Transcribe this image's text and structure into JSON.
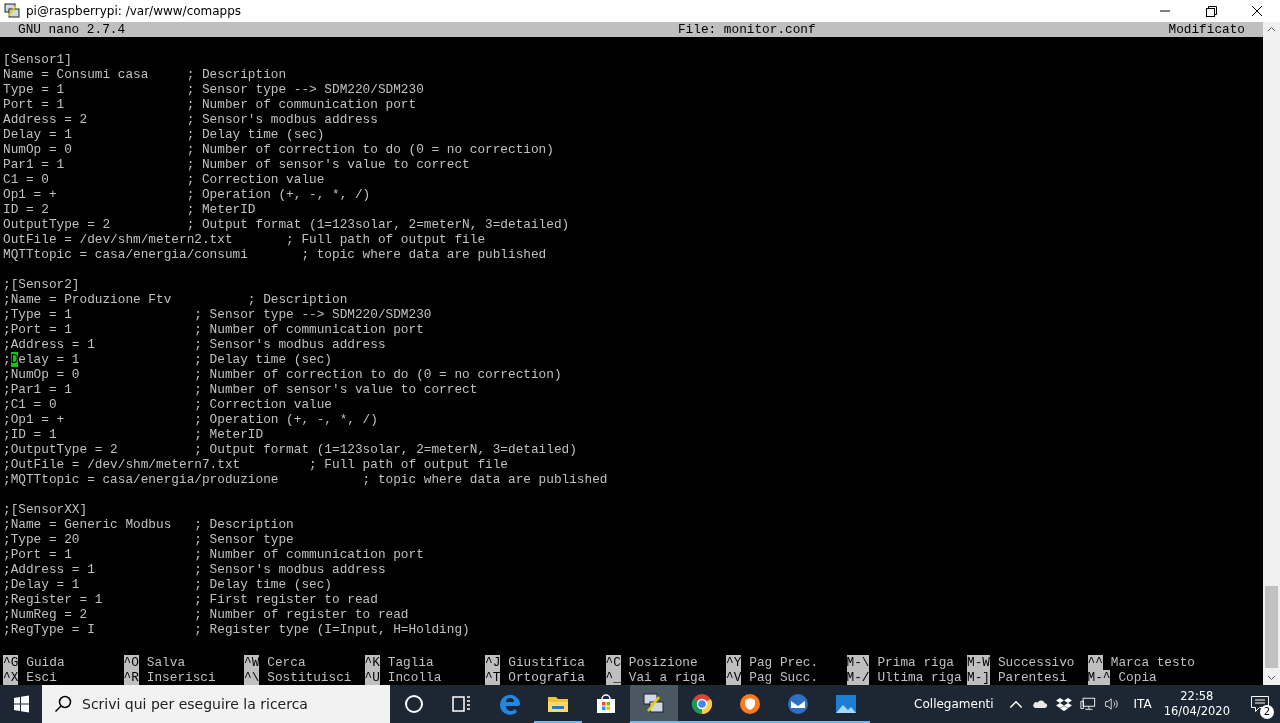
{
  "window": {
    "title": "pi@raspberrypi: /var/www/comapps"
  },
  "nano_header": {
    "version": "GNU nano 2.7.4",
    "file": "File: monitor.conf",
    "state": "Modificato"
  },
  "sections": [
    {
      "lines": [
        {
          "text": "[Sensor1]"
        },
        {
          "text": "Name = Consumi casa     ; Description"
        },
        {
          "text": "Type = 1                ; Sensor type --> SDM220/SDM230"
        },
        {
          "text": "Port = 1                ; Number of communication port"
        },
        {
          "text": "Address = 2             ; Sensor's modbus address"
        },
        {
          "text": "Delay = 1               ; Delay time (sec)"
        },
        {
          "text": "NumOp = 0               ; Number of correction to do (0 = no correction)"
        },
        {
          "text": "Par1 = 1                ; Number of sensor's value to correct"
        },
        {
          "text": "C1 = 0                  ; Correction value"
        },
        {
          "text": "Op1 = +                 ; Operation (+, -, *, /)"
        },
        {
          "text": "ID = 2                  ; MeterID"
        },
        {
          "text": "OutputType = 2          ; Output format (1=123solar, 2=meterN, 3=detailed)"
        },
        {
          "text": "OutFile = /dev/shm/metern2.txt       ; Full path of output file"
        },
        {
          "text": "MQTTtopic = casa/energia/consumi       ; topic where data are published"
        }
      ]
    },
    {
      "lines": [
        {
          "text": ";[Sensor2]"
        },
        {
          "text": ";Name = Produzione Ftv          ; Description"
        },
        {
          "text": ";Type = 1                ; Sensor type --> SDM220/SDM230"
        },
        {
          "text": ";Port = 1                ; Number of communication port"
        },
        {
          "text": ";Address = 1             ; Sensor's modbus address"
        },
        {
          "cursor_before": ";",
          "cursor_char": "D",
          "cursor_after": "elay = 1               ; Delay time (sec)"
        },
        {
          "text": ";NumOp = 0               ; Number of correction to do (0 = no correction)"
        },
        {
          "text": ";Par1 = 1                ; Number of sensor's value to correct"
        },
        {
          "text": ";C1 = 0                  ; Correction value"
        },
        {
          "text": ";Op1 = +                 ; Operation (+, -, *, /)"
        },
        {
          "text": ";ID = 1                  ; MeterID"
        },
        {
          "text": ";OutputType = 2          ; Output format (1=123solar, 2=meterN, 3=detailed)"
        },
        {
          "text": ";OutFile = /dev/shm/metern7.txt         ; Full path of output file"
        },
        {
          "text": ";MQTTtopic = casa/energia/produzione           ; topic where data are published"
        }
      ]
    },
    {
      "lines": [
        {
          "text": ";[SensorXX]"
        },
        {
          "text": ";Name = Generic Modbus   ; Description"
        },
        {
          "text": ";Type = 20               ; Sensor type"
        },
        {
          "text": ";Port = 1                ; Number of communication port"
        },
        {
          "text": ";Address = 1             ; Sensor's modbus address"
        },
        {
          "text": ";Delay = 1               ; Delay time (sec)"
        },
        {
          "text": ";Register = 1            ; First register to read"
        },
        {
          "text": ";NumReg = 2              ; Number of register to read"
        },
        {
          "text": ";RegType = I             ; Register type (I=Input, H=Holding)"
        }
      ]
    }
  ],
  "shortcuts": [
    {
      "key": "^G",
      "label": "Guida"
    },
    {
      "key": "^O",
      "label": "Salva"
    },
    {
      "key": "^W",
      "label": "Cerca"
    },
    {
      "key": "^K",
      "label": "Taglia"
    },
    {
      "key": "^J",
      "label": "Giustifica"
    },
    {
      "key": "^C",
      "label": "Posizione"
    },
    {
      "key": "^Y",
      "label": "Pag Prec."
    },
    {
      "key": "M-\\",
      "label": "Prima riga"
    },
    {
      "key": "M-W",
      "label": "Successivo"
    },
    {
      "key": "^^",
      "label": "Marca testo"
    },
    {
      "key": "^X",
      "label": "Esci"
    },
    {
      "key": "^R",
      "label": "Inserisci"
    },
    {
      "key": "^\\",
      "label": "Sostituisci"
    },
    {
      "key": "^U",
      "label": "Incolla"
    },
    {
      "key": "^T",
      "label": "Ortografia"
    },
    {
      "key": "^_",
      "label": "Vai a riga"
    },
    {
      "key": "^V",
      "label": "Pag Succ."
    },
    {
      "key": "M-/",
      "label": "Ultima riga"
    },
    {
      "key": "M-]",
      "label": "Parentesi"
    },
    {
      "key": "M-^",
      "label": "Copia"
    }
  ],
  "taskbar": {
    "search": {
      "placeholder": "Scrivi qui per eseguire la ricerca"
    },
    "apps": [
      {
        "kind": "cortana",
        "running": false,
        "selected": false
      },
      {
        "kind": "taskview",
        "running": false,
        "selected": false
      },
      {
        "kind": "edge",
        "running": false,
        "selected": false
      },
      {
        "kind": "explorer",
        "running": true,
        "selected": false
      },
      {
        "kind": "store",
        "running": false,
        "selected": false
      },
      {
        "kind": "putty",
        "running": true,
        "selected": true
      },
      {
        "kind": "chrome",
        "running": true,
        "selected": false
      },
      {
        "kind": "shield",
        "running": true,
        "selected": false
      },
      {
        "kind": "mail",
        "running": true,
        "selected": false
      },
      {
        "kind": "photos",
        "running": true,
        "selected": false
      }
    ],
    "toolbar_label": "Collegamenti",
    "language": "ITA",
    "time": "22:58",
    "date": "16/04/2020",
    "notifications": "2"
  }
}
